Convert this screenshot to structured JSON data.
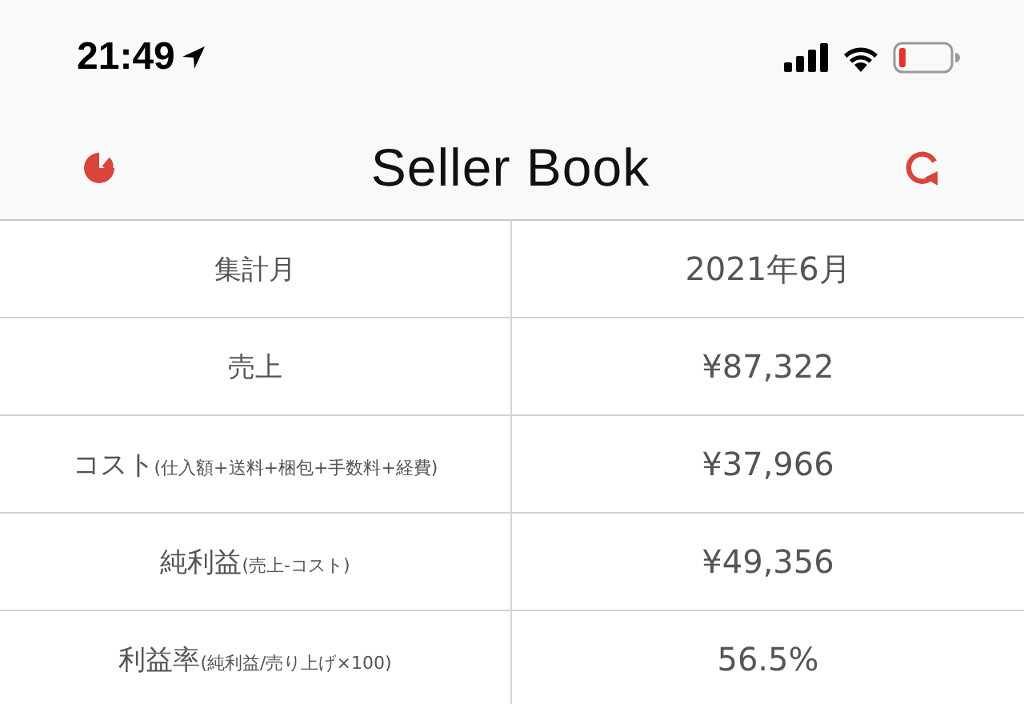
{
  "status_bar": {
    "time": "21:49"
  },
  "nav": {
    "title": "Seller Book"
  },
  "rows": [
    {
      "label": "集計月",
      "value": "2021年6月"
    },
    {
      "label": "売上",
      "value": "¥87,322"
    },
    {
      "label": "コスト",
      "note": "(仕入額+送料+梱包+手数料+経費)",
      "value": "¥37,966"
    },
    {
      "label": "純利益",
      "note": "(売上-コスト)",
      "value": "¥49,356"
    },
    {
      "label": "利益率",
      "note": "(純利益/売り上げ×100)",
      "value": "56.5%"
    }
  ]
}
